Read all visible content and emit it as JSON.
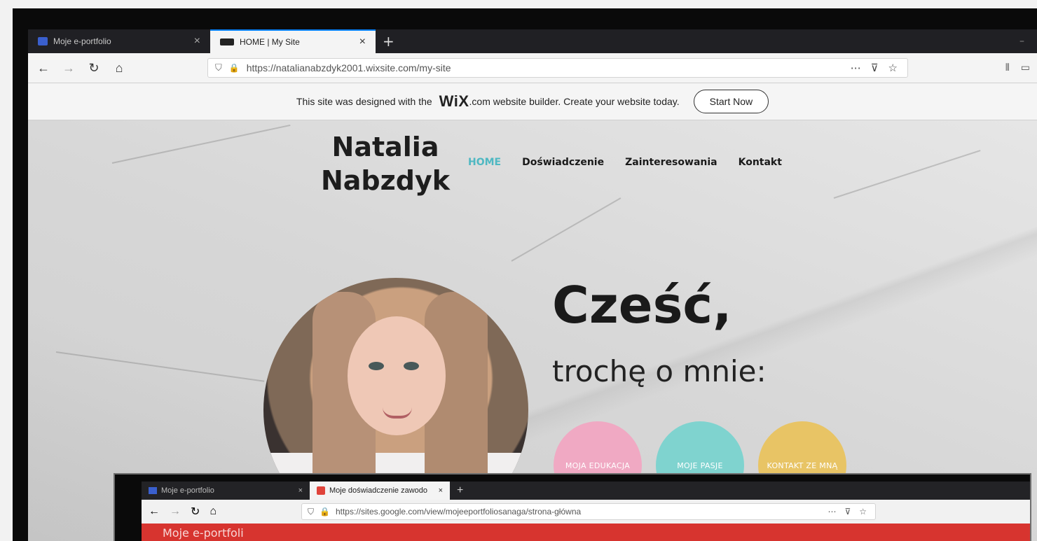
{
  "browser": {
    "tabs": [
      {
        "title": "Moje e-portfolio",
        "active": false
      },
      {
        "title": "HOME | My Site",
        "active": true
      }
    ],
    "url": "https://natalianabzdyk2001.wixsite.com/my-site",
    "new_tab": "+",
    "close_glyph": "×",
    "minimize_glyph": "–"
  },
  "wix_banner": {
    "text_before": "This site was designed with the",
    "logo": "WiX",
    "text_after": ".com website builder. Create your website today.",
    "button": "Start Now"
  },
  "site": {
    "name_line1": "Natalia",
    "name_line2": "Nabzdyk",
    "nav": [
      "HOME",
      "Doświadczenie",
      "Zainteresowania",
      "Kontakt"
    ],
    "greeting": "Cześć,",
    "subtitle": "trochę o mnie:",
    "circles": [
      {
        "label": "MOJA EDUKACJA",
        "color": "#f0a9c3"
      },
      {
        "label": "MOJE PASJE",
        "color": "#7fd3cf"
      },
      {
        "label": "KONTAKT ZE MNĄ",
        "color": "#e8c465"
      }
    ]
  },
  "overlay_browser": {
    "tabs": [
      {
        "title": "Moje e-portfolio",
        "active": false
      },
      {
        "title": "Moje doświadczenie zawodo",
        "active": true
      }
    ],
    "url": "https://sites.google.com/view/mojeeportfoliosanaga/strona-główna",
    "page_title_partial": "Moje e-portfoli"
  },
  "colors": {
    "accent_home": "#4fb8c2",
    "wix_favicon": "#3a5fcd",
    "google_favicon": "#e0443b"
  }
}
